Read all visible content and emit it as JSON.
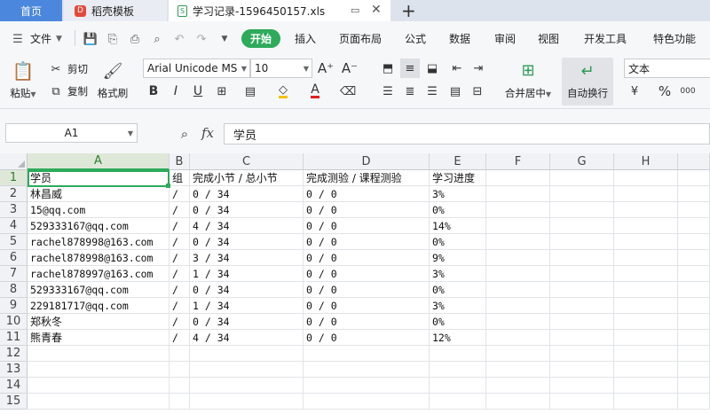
{
  "tabs": {
    "home": "首页",
    "template": "稻壳模板",
    "template_icon": "D",
    "file": "学习记录-1596450157.xls",
    "file_icon": "S"
  },
  "menu": {
    "file": "文件",
    "start": "开始",
    "items": [
      "插入",
      "页面布局",
      "公式",
      "数据",
      "审阅",
      "视图",
      "开发工具",
      "特色功能"
    ]
  },
  "ribbon": {
    "paste": "粘贴",
    "cut": "剪切",
    "copy": "复制",
    "format_painter": "格式刷",
    "font_name": "Arial Unicode MS",
    "font_size": "10",
    "merge_center": "合并居中",
    "wrap_text": "自动换行",
    "number_format": "文本",
    "percent": "%",
    "thousands": "000"
  },
  "formula_bar": {
    "cell_ref": "A1",
    "fx": "fx",
    "value": "学员"
  },
  "grid": {
    "columns": [
      "A",
      "B",
      "C",
      "D",
      "E",
      "F",
      "G",
      "H"
    ],
    "rows": [
      "1",
      "2",
      "3",
      "4",
      "5",
      "6",
      "7",
      "8",
      "9",
      "10",
      "11",
      "12",
      "13",
      "14",
      "15"
    ],
    "data": [
      [
        "学员",
        "组",
        "完成小节 / 总小节",
        "完成测验 / 课程测验",
        "学习进度"
      ],
      [
        "林昌威",
        "/",
        "0 / 34",
        "0 / 0",
        "3%"
      ],
      [
        "15@qq.com",
        "/",
        "0 / 34",
        "0 / 0",
        "0%"
      ],
      [
        "529333167@qq.com",
        "/",
        "4 / 34",
        "0 / 0",
        "14%"
      ],
      [
        "rachel878998@163.com",
        "/",
        "0 / 34",
        "0 / 0",
        "0%"
      ],
      [
        "rachel878998@163.com",
        "/",
        "3 / 34",
        "0 / 0",
        "9%"
      ],
      [
        "rachel878997@163.com",
        "/",
        "1 / 34",
        "0 / 0",
        "3%"
      ],
      [
        "529333167@qq.com",
        "/",
        "0 / 34",
        "0 / 0",
        "0%"
      ],
      [
        "229181717@qq.com",
        "/",
        "1 / 34",
        "0 / 0",
        "3%"
      ],
      [
        "郑秋冬",
        "/",
        "0 / 34",
        "0 / 0",
        "0%"
      ],
      [
        "熊青春",
        "/",
        "4 / 34",
        "0 / 0",
        "12%"
      ]
    ]
  },
  "colors": {
    "accent": "#2eaa5b",
    "home_tab": "#4b87dd"
  }
}
